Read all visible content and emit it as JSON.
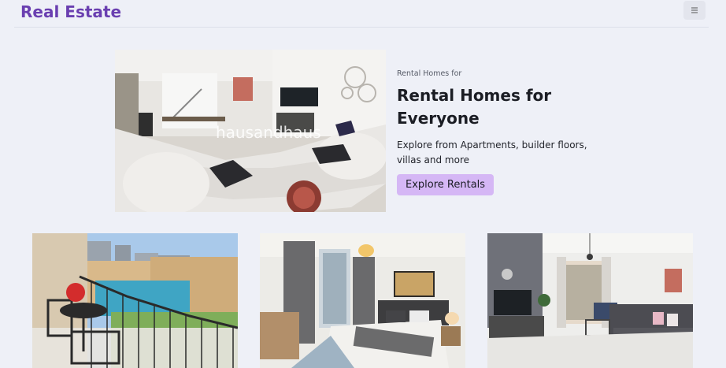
{
  "header": {
    "brand": "Real Estate",
    "menu_icon": "hamburger-icon"
  },
  "hero": {
    "image_watermark": "hausandhaus",
    "eyebrow": "Rental Homes for",
    "title": "Rental Homes for Everyone",
    "description": "Explore from Apartments, builder floors, villas and more",
    "cta_label": "Explore Rentals"
  },
  "colors": {
    "brand": "#6a3fb0",
    "cta_background": "#d5b7f5",
    "page_background": "#eef0f7"
  },
  "cards": [
    {
      "image": "balcony-pool-view-photo"
    },
    {
      "image": "bedroom-photo"
    },
    {
      "image": "living-room-photo"
    }
  ]
}
